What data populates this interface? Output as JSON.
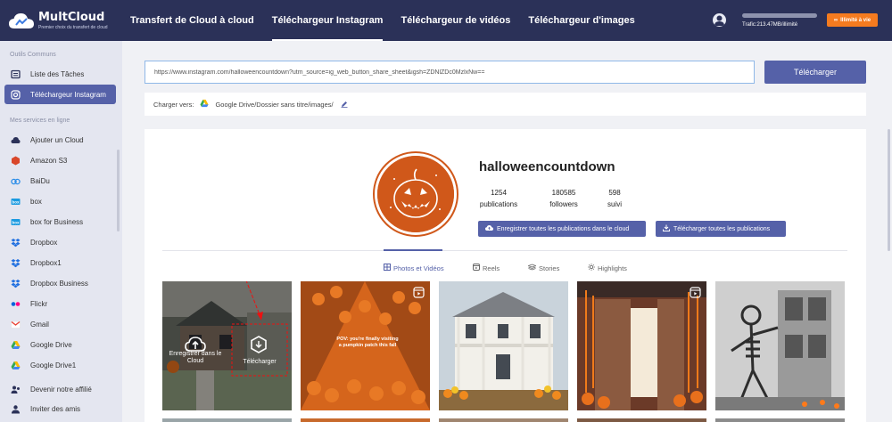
{
  "brand": {
    "name": "MultCloud",
    "tagline": "Premier choix du transfert de cloud"
  },
  "nav": {
    "items": [
      {
        "label": "Transfert de Cloud à cloud"
      },
      {
        "label": "Téléchargeur Instagram"
      },
      {
        "label": "Téléchargeur de vidéos"
      },
      {
        "label": "Téléchargeur d'images"
      }
    ],
    "active_index": 1
  },
  "header": {
    "traffic_text": "Trafic:213.47MB/illimité",
    "limit_label": "Illimité à vie"
  },
  "sidebar": {
    "section_tools": "Outils Communs",
    "tools": [
      {
        "label": "Liste des Tâches",
        "icon": "task-list-icon"
      },
      {
        "label": "Téléchargeur Instagram",
        "icon": "instagram-icon"
      }
    ],
    "section_services": "Mes services en ligne",
    "services": [
      {
        "label": "Ajouter un Cloud",
        "icon": "add-cloud-icon"
      },
      {
        "label": "Amazon S3",
        "icon": "amazon-s3-icon"
      },
      {
        "label": "BaiDu",
        "icon": "baidu-icon"
      },
      {
        "label": "box",
        "icon": "box-icon"
      },
      {
        "label": "box for Business",
        "icon": "box-business-icon"
      },
      {
        "label": "Dropbox",
        "icon": "dropbox-icon"
      },
      {
        "label": "Dropbox1",
        "icon": "dropbox-icon"
      },
      {
        "label": "Dropbox Business",
        "icon": "dropbox-business-icon"
      },
      {
        "label": "Flickr",
        "icon": "flickr-icon"
      },
      {
        "label": "Gmail",
        "icon": "gmail-icon"
      },
      {
        "label": "Google Drive",
        "icon": "google-drive-icon"
      },
      {
        "label": "Google Drive1",
        "icon": "google-drive-icon"
      }
    ],
    "footer": [
      {
        "label": "Devenir notre affilié",
        "icon": "affiliate-icon"
      },
      {
        "label": "Inviter des amis",
        "icon": "invite-icon"
      }
    ]
  },
  "download": {
    "url_value": "https://www.instagram.com/halloweencountdown?utm_source=ig_web_button_share_sheet&igsh=ZDNlZDc0MzlxNw==",
    "button_label": "Télécharger",
    "target_label": "Charger vers:",
    "target_path": "Google Drive/Dossier sans titre/images/"
  },
  "profile": {
    "username": "halloweencountdown",
    "stats": [
      {
        "value": "1254",
        "label": "publications"
      },
      {
        "value": "180585",
        "label": "followers"
      },
      {
        "value": "598",
        "label": "suivi"
      }
    ],
    "save_all_label": "Enregistrer toutes les publications dans le cloud",
    "download_all_label": "Télécharger toutes les publications"
  },
  "tabs": [
    {
      "label": "Photos et Vidéos",
      "icon": "grid-icon"
    },
    {
      "label": "Reels",
      "icon": "reels-icon"
    },
    {
      "label": "Stories",
      "icon": "stories-icon"
    },
    {
      "label": "Highlights",
      "icon": "highlights-icon"
    }
  ],
  "posts": {
    "overlay_save_label": "Enregistrer dans le Cloud",
    "overlay_download_label": "Télécharger",
    "pumpkin_caption": "POV: you're finally visiting a pumpkin patch this fall"
  },
  "colors": {
    "topbar": "#2b3158",
    "accent": "#5561a8",
    "orange": "#f57b1f",
    "pumpkin": "#d0581a"
  }
}
